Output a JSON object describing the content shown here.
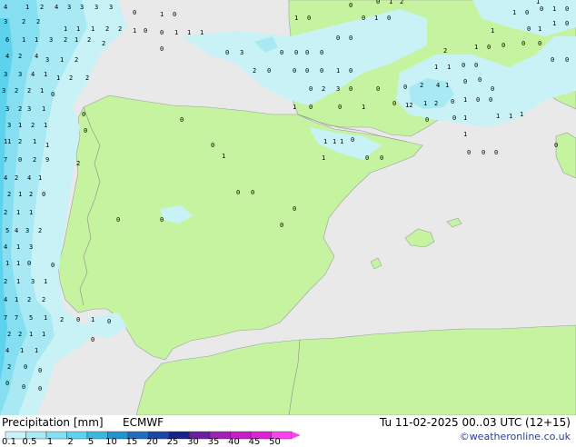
{
  "legend": {
    "title": "Precipitation [mm]",
    "model": "ECMWF",
    "datetime": "Tu 11-02-2025 00..03 UTC (12+15)",
    "credit": "©weatheronline.co.uk",
    "scale_labels": [
      "0.1",
      "0.5",
      "1",
      "2",
      "5",
      "10",
      "15",
      "20",
      "25",
      "30",
      "35",
      "40",
      "45",
      "50"
    ],
    "scale_colors": [
      "#c9f2f7",
      "#a8e9f3",
      "#86dff0",
      "#5dd2ec",
      "#3bb8e0",
      "#1f94d0",
      "#1f6cc0",
      "#1b46a8",
      "#16248c",
      "#6a1ea0",
      "#a020b8",
      "#c81ec8",
      "#e020d8",
      "#ff40f0"
    ]
  },
  "map": {
    "colors": {
      "sea": "#e9e9e9",
      "land": "#c6f3a0",
      "precip_light": "#c9f2f7",
      "precip_mid": "#a8e9f3",
      "precip_heavy": "#86dff0",
      "precip_strong": "#5dd2ec",
      "coast": "#9aa0a0",
      "border": "#8c8c8c"
    }
  }
}
